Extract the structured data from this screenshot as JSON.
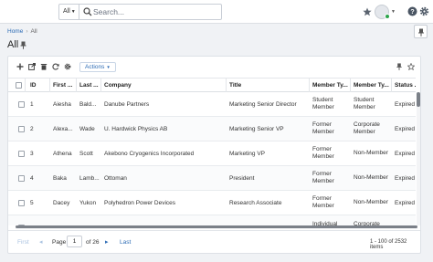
{
  "search": {
    "scope": "All",
    "placeholder": "Search..."
  },
  "breadcrumb": {
    "home": "Home",
    "current": "All"
  },
  "page": {
    "title": "All"
  },
  "toolbar": {
    "actions_label": "Actions"
  },
  "grid": {
    "columns": [
      "ID",
      "First ...",
      "Last ...",
      "Company",
      "Title",
      "Member Ty...",
      "Member Ty...",
      "Status ..."
    ],
    "rows": [
      {
        "id": "1",
        "first": "Aiesha",
        "last": "Bald...",
        "company": "Danube Partners",
        "title": "Marketing Senior Director",
        "member_type_1": "Student Member",
        "member_type_2": "Student Member",
        "status": "Expired"
      },
      {
        "id": "2",
        "first": "Alexa...",
        "last": "Wade",
        "company": "U. Hardwick Physics AB",
        "title": "Marketing Senior VP",
        "member_type_1": "Former Member",
        "member_type_2": "Corporate Member",
        "status": "Expired"
      },
      {
        "id": "3",
        "first": "Athena",
        "last": "Scott",
        "company": "Akebono Cryogenics Incorporated",
        "title": "Marketing VP",
        "member_type_1": "Former Member",
        "member_type_2": "Non-Member",
        "status": "Expired"
      },
      {
        "id": "4",
        "first": "Baka",
        "last": "Lamb...",
        "company": "Ottoman",
        "title": "President",
        "member_type_1": "Former Member",
        "member_type_2": "Non-Member",
        "status": "Expired"
      },
      {
        "id": "5",
        "first": "Dacey",
        "last": "Yukon",
        "company": "Polyhedron Power Devices",
        "title": "Research Associate",
        "member_type_1": "Former Member",
        "member_type_2": "Non-Member",
        "status": "Expired"
      },
      {
        "id": "",
        "first": "",
        "last": "",
        "company": "",
        "title": "",
        "member_type_1": "Individual",
        "member_type_2": "Corporate",
        "status": ""
      }
    ]
  },
  "pager": {
    "first": "First",
    "page_label": "Page",
    "page_value": "1",
    "of_label": "of 26",
    "last": "Last",
    "summary": "1 - 100 of 2532 items"
  }
}
